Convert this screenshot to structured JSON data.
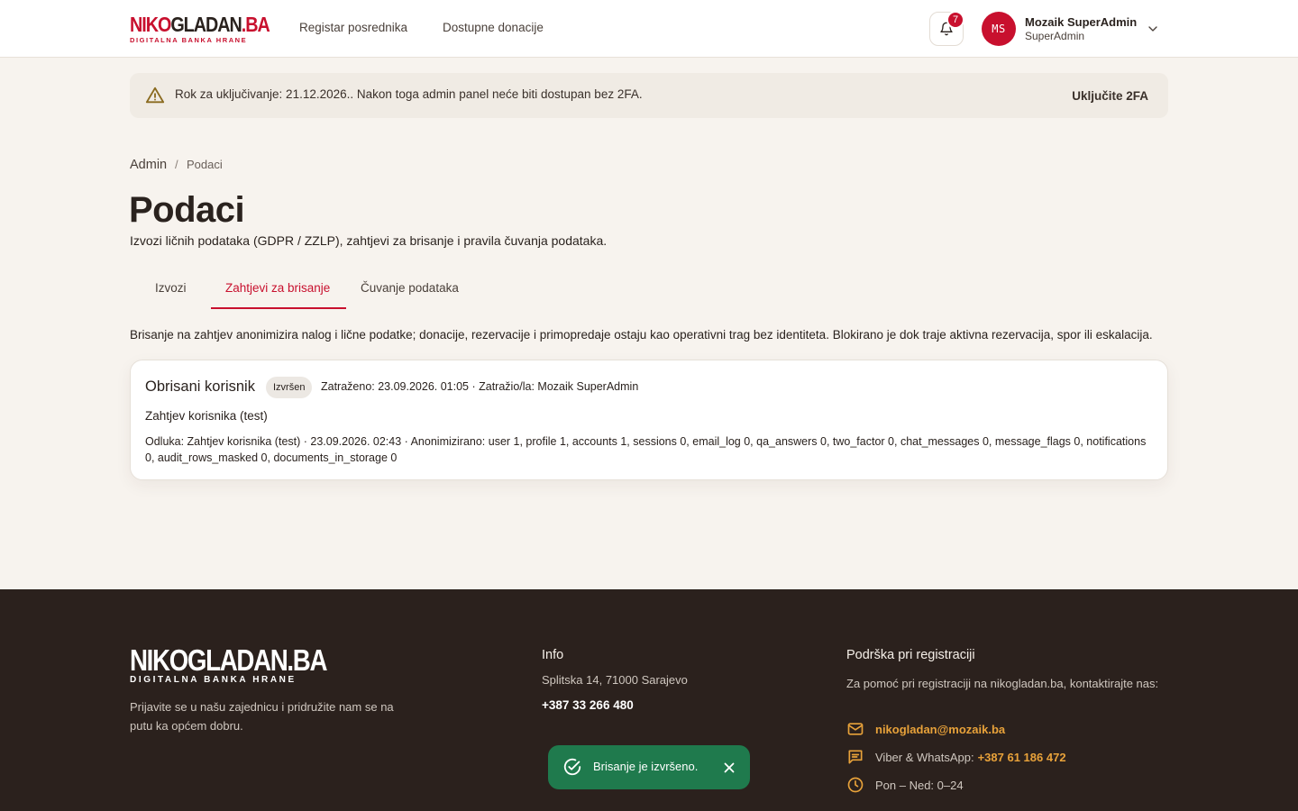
{
  "header": {
    "logo_word_a": "NIKO",
    "logo_word_b": "GLADAN",
    "logo_word_c": ".BA",
    "logo_tagline": "DIGITALNA BANKA HRANE",
    "nav": [
      "Registar posrednika",
      "Dostupne donacije"
    ],
    "notifications_count": "7",
    "user_initials": "MS",
    "user_name": "Mozaik SuperAdmin",
    "user_role": "SuperAdmin"
  },
  "alert": {
    "text": "Rok za uključivanje: 21.12.2026.. Nakon toga admin panel neće biti dostupan bez 2FA.",
    "action": "Uključite 2FA"
  },
  "breadcrumb": {
    "root": "Admin",
    "separator": "/",
    "current": "Podaci"
  },
  "page": {
    "title": "Podaci",
    "subtitle": "Izvozi ličnih podataka (GDPR / ZZLP), zahtjevi za brisanje i pravila čuvanja podataka."
  },
  "tabs": [
    {
      "label": "Izvozi",
      "active": false
    },
    {
      "label": "Zahtjevi za brisanje",
      "active": true
    },
    {
      "label": "Čuvanje podataka",
      "active": false
    }
  ],
  "description": "Brisanje na zahtjev anonimizira nalog i lične podatke; donacije, rezervacije i primopredaje ostaju kao operativni trag bez identiteta. Blokirano je dok traje aktivna rezervacija, spor ili eskalacija.",
  "requests": [
    {
      "title": "Obrisani korisnik",
      "status": "Izvršen",
      "meta": "Zatraženo: 23.09.2026. 01:05 · Zatražio/la: Mozaik SuperAdmin",
      "reason": "Zahtjev korisnika (test)",
      "decision": "Odluka: Zahtjev korisnika (test) · 23.09.2026. 02:43 · Anonimizirano: user 1, profile 1, accounts 1, sessions 0, email_log 0, qa_answers 0, two_factor 0, chat_messages 0, message_flags 0, notifications 0, audit_rows_masked 0, documents_in_storage 0"
    }
  ],
  "footer": {
    "logo_word": "NIKOGLADAN.BA",
    "logo_tagline": "DIGITALNA BANKA HRANE",
    "about": "Prijavite se u našu zajednicu i pridružite nam se na putu ka općem dobru.",
    "info_heading": "Info",
    "address": "Splitska 14, 71000 Sarajevo",
    "phone": "+387 33 266 480",
    "support_heading": "Podrška pri registraciji",
    "support_text": "Za pomoć pri registraciji na nikogladan.ba, kontaktirajte nas:",
    "email": "nikogladan@mozaik.ba",
    "viber_label": "Viber & WhatsApp:",
    "viber_value": "+387 61 186 472",
    "hours": "Pon – Ned: 0–24"
  },
  "toast": {
    "text": "Brisanje je izvršeno."
  },
  "colors": {
    "brand_red": "#c8102e",
    "footer_bg": "#2b211d",
    "accent_orange": "#e8a23a",
    "success_green": "#1f7a4d",
    "page_bg": "#f7f3ee"
  },
  "icons": [
    "bell-icon",
    "chevron-down-icon",
    "warning-icon",
    "mail-icon",
    "chat-icon",
    "clock-icon",
    "check-circle-icon",
    "close-icon"
  ]
}
